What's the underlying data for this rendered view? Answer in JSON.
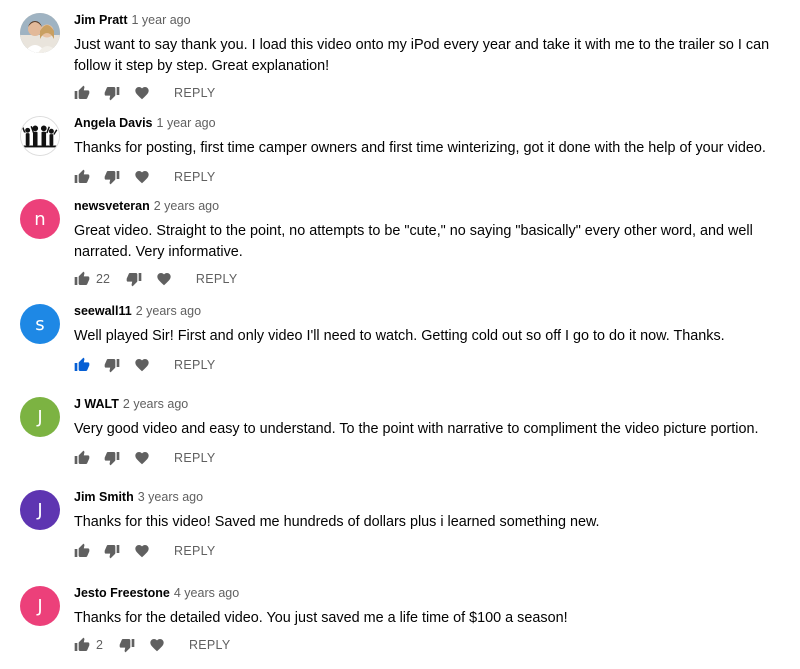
{
  "icons": {
    "like": "thumb-up-icon",
    "dislike": "thumb-down-icon",
    "heart": "heart-icon"
  },
  "colors": {
    "liked_blue": "#065fd4",
    "icon_gray": "#606060"
  },
  "comments": [
    {
      "author": "Jim Pratt",
      "time": "1 year ago",
      "avatar": "",
      "avatar_color": "#c8ab8c",
      "text": "Just want to say thank you.  I load this video onto my iPod every year and take it with me to the trailer so I can follow it step by step. Great explanation!",
      "likes": "",
      "reply": "REPLY"
    },
    {
      "author": "Angela Davis",
      "time": "1 year ago",
      "avatar": "",
      "avatar_color": "#ffffff",
      "text": "Thanks for posting, first time camper owners and first time winterizing, got it done with the help of your video.",
      "likes": "",
      "reply": "REPLY"
    },
    {
      "author": "newsveteran",
      "time": "2 years ago",
      "avatar": "n",
      "avatar_color": "#ec407a",
      "text": "Great video.  Straight to the point, no attempts to be \"cute,\" no saying \"basically\" every other word, and well narrated.  Very informative.",
      "likes": "22",
      "reply": "REPLY"
    },
    {
      "author": "seewall11",
      "time": "2 years ago",
      "avatar": "s",
      "avatar_color": "#1e88e5",
      "text": "Well played Sir! First and only video I'll need to watch. Getting cold out so off I go to do it now. Thanks.",
      "likes": "",
      "reply": "REPLY",
      "liked": true
    },
    {
      "author": "J WALT",
      "time": "2 years ago",
      "avatar": "J",
      "avatar_color": "#7cb342",
      "text": "Very good video and easy to understand. To the point with narrative to compliment the video picture portion.",
      "likes": "",
      "reply": "REPLY"
    },
    {
      "author": "Jim Smith",
      "time": "3 years ago",
      "avatar": "J",
      "avatar_color": "#5e35b1",
      "text": "Thanks for this video! Saved me hundreds of dollars plus i learned something new.",
      "likes": "",
      "reply": "REPLY"
    },
    {
      "author": "Jesto Freestone",
      "time": "4 years ago",
      "avatar": "J",
      "avatar_color": "#ec407a",
      "text": "Thanks for the detailed video.  You just saved me a life time of $100 a season!",
      "likes": "2",
      "reply": "REPLY"
    }
  ]
}
